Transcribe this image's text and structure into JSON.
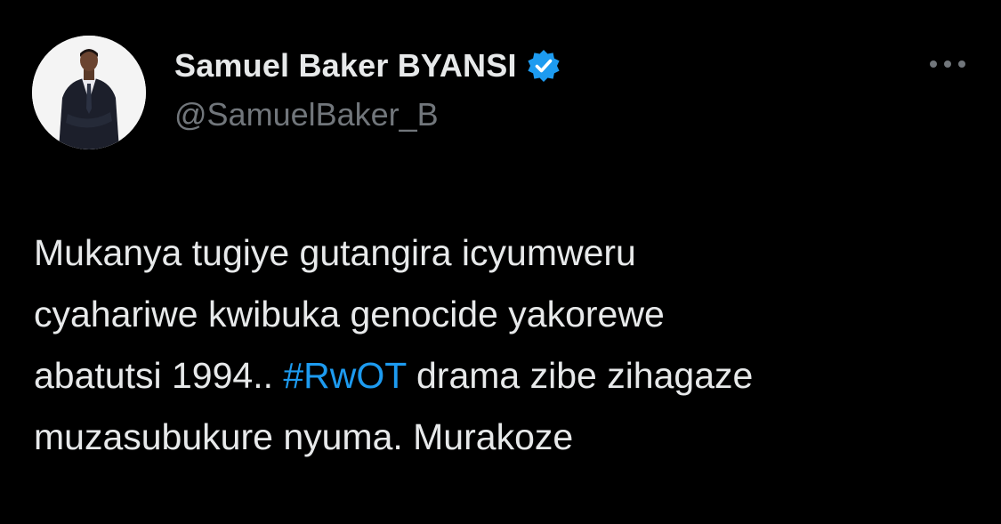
{
  "colors": {
    "background": "#000000",
    "primary_text": "#e7e9ea",
    "secondary_text": "#71767b",
    "link": "#1d9bf0",
    "verified_badge": "#1d9bf0"
  },
  "author": {
    "display_name": "Samuel Baker BYANSI",
    "handle": "@SamuelBaker_B",
    "verified_icon": "verified-badge-icon",
    "avatar": "profile-photo"
  },
  "actions": {
    "more_icon": "more-options-icon"
  },
  "tweet": {
    "line1": "Mukanya tugiye gutangira icyumweru",
    "line2": "cyahariwe kwibuka genocide yakorewe",
    "line3_before": "abatutsi 1994.. ",
    "hashtag": "#RwOT",
    "line3_after": " drama zibe zihagaze",
    "line4": "muzasubukure nyuma. Murakoze"
  }
}
